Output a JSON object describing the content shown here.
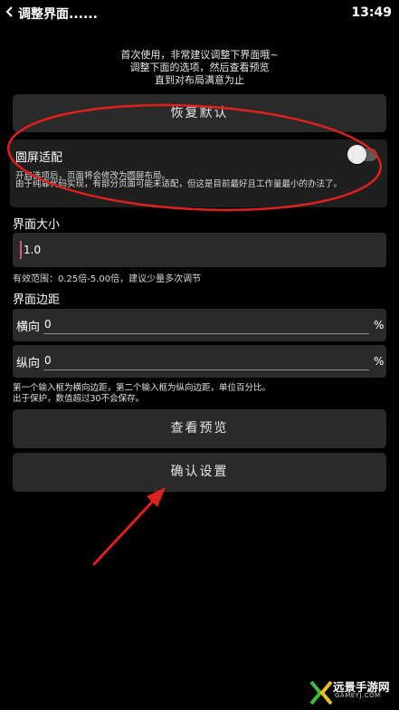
{
  "status_bar": {
    "time": "13:49"
  },
  "header": {
    "title": "调整界面......",
    "back_icon": "chevron-left-icon"
  },
  "intro": {
    "line1": "首次使用，非常建议调整下界面哦~",
    "line2": "调整下面的选项，然后查看预览",
    "line3": "直到对布局满意为止"
  },
  "buttons": {
    "restore": "恢复默认",
    "preview": "查看预览",
    "confirm": "确认设置"
  },
  "round_screen": {
    "label": "圆屏适配",
    "desc1": "开启选项后，页面将会修改为圆屏布局。",
    "desc2": "由于纯靠代码实现，有部分页面可能未适配，但这是目前最好且工作量最小的办法了。",
    "enabled": false
  },
  "ui_size": {
    "label": "界面大小",
    "value": "1.0",
    "hint": "有效范围：0.25倍-5.00倍，建议少量多次调节"
  },
  "margin": {
    "label": "界面边距",
    "horizontal_label": "横向",
    "horizontal_value": "0",
    "vertical_label": "纵向",
    "vertical_value": "0",
    "unit": "%",
    "hint1": "第一个输入框为横向边距，第二个输入框为纵向边距，单位百分比。",
    "hint2": "出于保护，数值超过30不会保存。"
  },
  "watermark": {
    "text": "远景手游网",
    "sub": "GAMEYJ.COM"
  },
  "colors": {
    "background": "#000000",
    "card": "#2a2a2a",
    "annotation_red": "#e0201c"
  }
}
